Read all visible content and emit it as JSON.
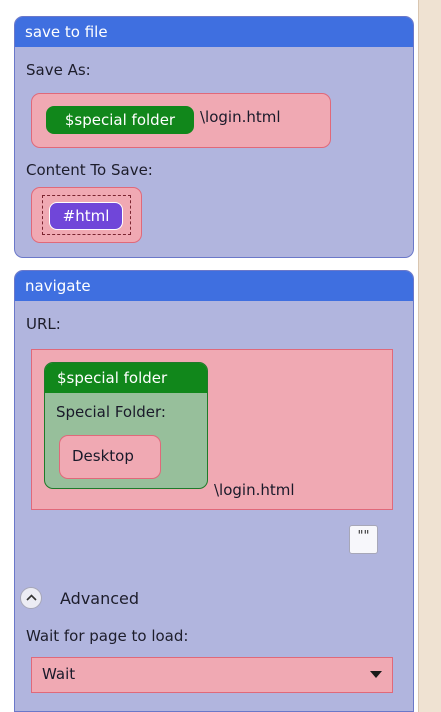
{
  "save_to_file": {
    "title": "save to file",
    "save_as_label": "Save As:",
    "special_folder_pill": "$special folder",
    "save_as_suffix": "\\login.html",
    "content_label": "Content To Save:",
    "content_pill": "#html"
  },
  "navigate": {
    "title": "navigate",
    "url_label": "URL:",
    "special_folder_card": {
      "title": "$special folder",
      "field_label": "Special Folder:",
      "value": "Desktop"
    },
    "url_suffix": "\\login.html",
    "ellipsis_button": "\"\"",
    "advanced_label": "Advanced",
    "wait_label": "Wait for page to load:",
    "wait_value": "Wait"
  },
  "colors": {
    "header_blue": "#3f6fe0",
    "block_bg": "#b1b5de",
    "pink_field": "#f0a9b3",
    "green_pill": "#11871b",
    "purple_pill": "#7046d9"
  }
}
